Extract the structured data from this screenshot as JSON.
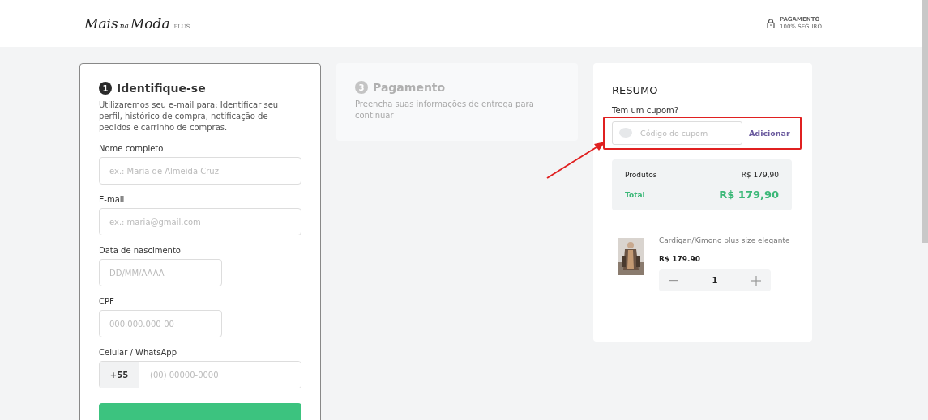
{
  "header": {
    "logo": {
      "main": "Mais",
      "small": "na",
      "second": "Moda",
      "suffix": "PLUS"
    },
    "secure": {
      "title": "PAGAMENTO",
      "subtitle": "100% SEGURO"
    }
  },
  "identify": {
    "step": "1",
    "title": "Identifique-se",
    "description": "Utilizaremos seu e-mail para: Identificar seu perfil, histórico de compra, notificação de pedidos e carrinho de compras.",
    "fields": [
      {
        "kind": "full",
        "label": "Nome completo",
        "placeholder": "ex.: Maria de Almeida Cruz"
      },
      {
        "kind": "full",
        "label": "E-mail",
        "placeholder": "ex.: maria@gmail.com"
      },
      {
        "kind": "short",
        "label": "Data de nascimento",
        "placeholder": "DD/MM/AAAA"
      },
      {
        "kind": "short",
        "label": "CPF",
        "placeholder": "000.000.000-00"
      },
      {
        "kind": "phone",
        "label": "Celular / WhatsApp",
        "prefix": "+55",
        "placeholder": "(00) 00000-0000"
      }
    ]
  },
  "payment": {
    "step": "3",
    "title": "Pagamento",
    "description": "Preencha suas informações de entrega para continuar",
    "disabled": true
  },
  "summary": {
    "title": "RESUMO",
    "coupon_label": "Tem um cupom?",
    "coupon_placeholder": "Código do cupom",
    "coupon_button": "Adicionar",
    "products_label": "Produtos",
    "products_value": "R$ 179,90",
    "total_label": "Total",
    "total_value": "R$ 179,90",
    "item": {
      "name": "Cardigan/Kimono plus size elegante",
      "price": "R$ 179.90",
      "quantity": "1"
    }
  }
}
